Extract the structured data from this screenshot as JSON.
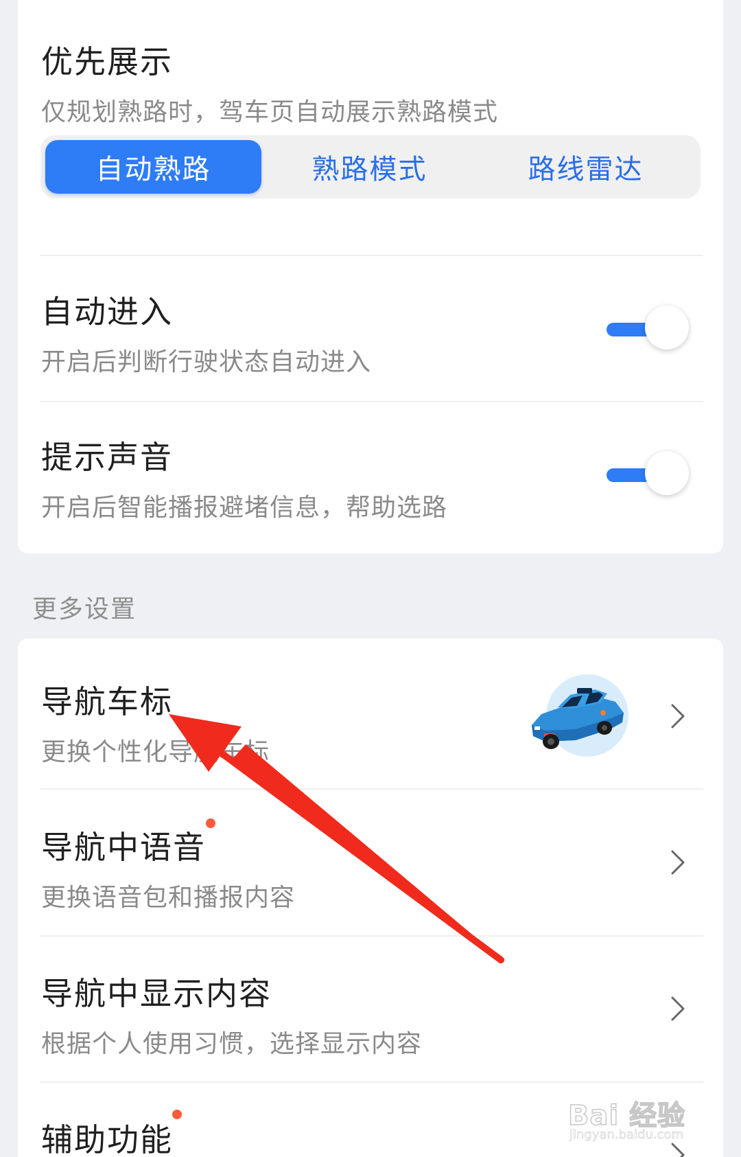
{
  "priority": {
    "title": "优先展示",
    "subtitle": "仅规划熟路时，驾车页自动展示熟路模式",
    "options": [
      {
        "label": "自动熟路",
        "selected": true
      },
      {
        "label": "熟路模式",
        "selected": false
      },
      {
        "label": "路线雷达",
        "selected": false
      }
    ]
  },
  "auto_enter": {
    "title": "自动进入",
    "subtitle": "开启后判断行驶状态自动进入",
    "enabled": true
  },
  "sound": {
    "title": "提示声音",
    "subtitle": "开启后智能播报避堵信息，帮助选路",
    "enabled": true
  },
  "more_settings": {
    "label": "更多设置",
    "items": [
      {
        "title": "导航车标",
        "subtitle": "更换个性化导航车标",
        "has_dot": false,
        "icon": "car-avatar-icon"
      },
      {
        "title": "导航中语音",
        "subtitle": "更换语音包和播报内容",
        "has_dot": true
      },
      {
        "title": "导航中显示内容",
        "subtitle": "根据个人使用习惯，选择显示内容",
        "has_dot": false
      },
      {
        "title": "辅助功能",
        "subtitle": "",
        "has_dot": true
      }
    ]
  },
  "watermark": {
    "brand": "Bai 经验",
    "url": "jingyan.baidu.com"
  },
  "colors": {
    "accent": "#2e7cf6",
    "dot": "#ff5a3c",
    "annotation_arrow": "#f02a1c"
  }
}
